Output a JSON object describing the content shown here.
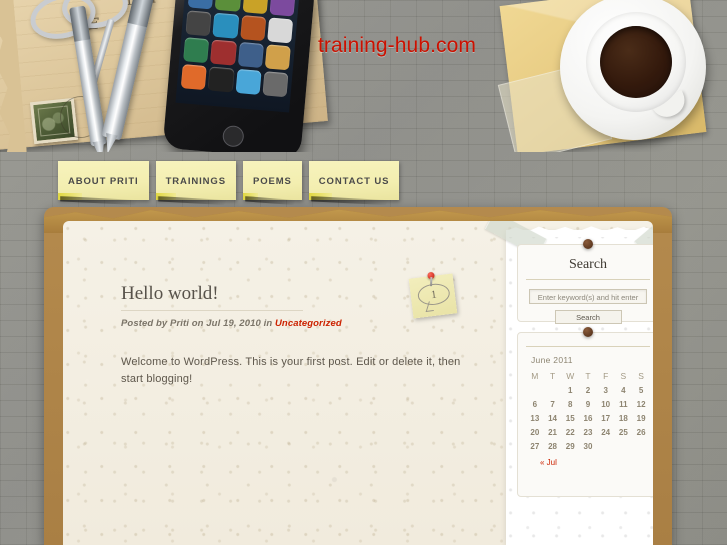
{
  "site": {
    "title": "training-hub.com",
    "title_color": "#cc1100"
  },
  "nav": {
    "items": [
      {
        "label": "ABOUT PRITI",
        "name": "nav-about-priti"
      },
      {
        "label": "TRAININGS",
        "name": "nav-trainings"
      },
      {
        "label": "POEMS",
        "name": "nav-poems"
      },
      {
        "label": "CONTACT US",
        "name": "nav-contact-us"
      }
    ]
  },
  "post": {
    "title": "Hello world!",
    "meta_prefix": "Posted by Priti on Jul 19, 2010 in ",
    "category": "Uncategorized",
    "body": "Welcome to WordPress. This is your first post. Edit or delete it, then start blogging!",
    "comment_count": "1"
  },
  "sidebar": {
    "search": {
      "title": "Search",
      "input_value": "",
      "input_placeholder": "Enter keyword(s) and hit enter",
      "button_label": "Search"
    },
    "calendar": {
      "title": "",
      "caption": "June 2011",
      "weekdays": [
        "M",
        "T",
        "W",
        "T",
        "F",
        "S",
        "S"
      ],
      "weeks": [
        [
          "",
          "",
          "1",
          "2",
          "3",
          "4",
          "5"
        ],
        [
          "6",
          "7",
          "8",
          "9",
          "10",
          "11",
          "12"
        ],
        [
          "13",
          "14",
          "15",
          "16",
          "17",
          "18",
          "19"
        ],
        [
          "20",
          "21",
          "22",
          "23",
          "24",
          "25",
          "26"
        ],
        [
          "27",
          "28",
          "29",
          "30",
          "",
          "",
          ""
        ]
      ],
      "prev_link": "« Jul"
    }
  }
}
